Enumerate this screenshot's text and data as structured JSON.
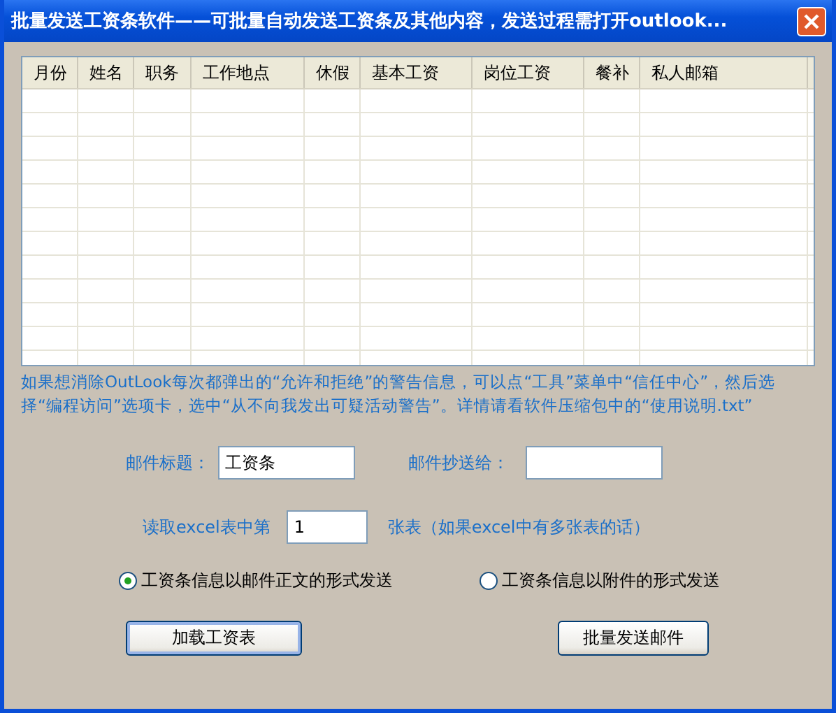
{
  "window": {
    "title": "批量发送工资条软件——可批量自动发送工资条及其他内容，发送过程需打开outlook..."
  },
  "table": {
    "columns": [
      "月份",
      "姓名",
      "职务",
      "工作地点",
      "休假",
      "基本工资",
      "岗位工资",
      "餐补",
      "私人邮箱"
    ]
  },
  "note": "如果想消除OutLook每次都弹出的“允许和拒绝”的警告信息，可以点“工具”菜单中“信任中心”，然后选择“编程访问”选项卡，选中“从不向我发出可疑活动警告”。详情请看软件压缩包中的“使用说明.txt”",
  "subject": {
    "label": "邮件标题：",
    "value": "工资条"
  },
  "cc": {
    "label": "邮件抄送给："
  },
  "sheet": {
    "label": "读取excel表中第",
    "value": "1",
    "suffix": "张表（如果excel中有多张表的话）"
  },
  "send_modes": [
    {
      "label": "工资条信息以邮件正文的形式发送",
      "selected": true
    },
    {
      "label": "工资条信息以附件的形式发送",
      "selected": false
    }
  ],
  "buttons": [
    {
      "label": "加载工资表",
      "focused": true
    },
    {
      "label": "批量发送邮件",
      "focused": false
    }
  ]
}
